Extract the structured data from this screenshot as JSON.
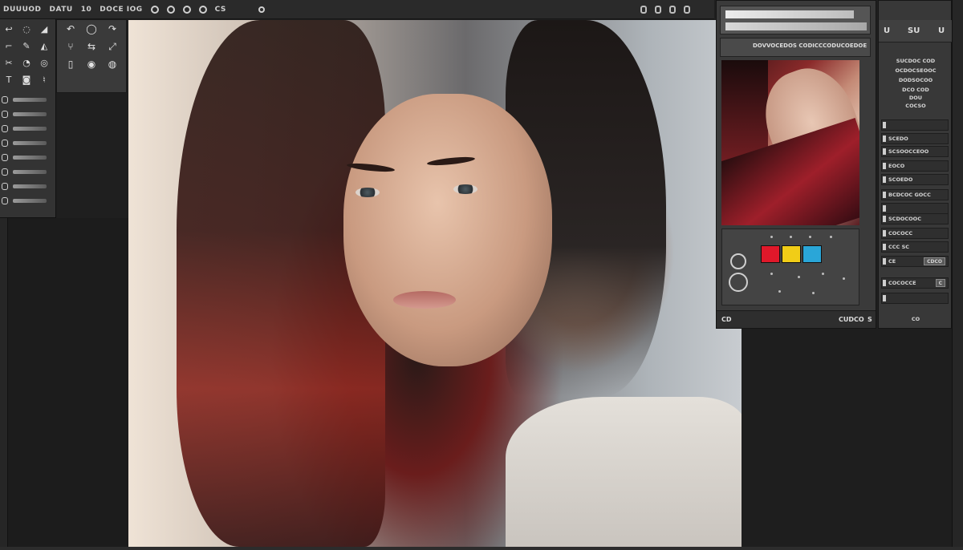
{
  "menubar": {
    "items": [
      "DUUUOD",
      "DATU",
      "10",
      "DOCE IOG",
      "CS"
    ]
  },
  "right_panel": {
    "header_label": "DOVVOCEDOS CODICCCODUCOEDOE",
    "swatches": [
      "#e0182a",
      "#f1cd17",
      "#2aa6d8"
    ],
    "status": {
      "left": "CD",
      "mid": "CUDCO",
      "right": "S"
    }
  },
  "far_panel": {
    "header": {
      "left": "U",
      "mid": "SU",
      "right": "U"
    },
    "description": [
      "SUCDOC COD",
      "OCDOCSEOOC",
      "DODSOCOO",
      "DCO COD",
      "DOU",
      "COCSO"
    ],
    "rows": [
      {
        "label": "",
        "tag": ""
      },
      {
        "label": "SCEDO",
        "tag": ""
      },
      {
        "label": "SCSOOCCEOO",
        "tag": ""
      },
      {
        "label": "EOCO",
        "tag": ""
      },
      {
        "label": "SCOEDO",
        "tag": ""
      },
      {
        "label": "BCDCOC GOCC",
        "tag": ""
      },
      {
        "label": "",
        "tag": ""
      },
      {
        "label": "SCDOCOOC",
        "tag": ""
      },
      {
        "label": "COCOCC",
        "tag": ""
      },
      {
        "label": "CCC SC",
        "tag": ""
      },
      {
        "label": "CE",
        "tag": "CDCO"
      },
      {
        "label": "COCOCCE",
        "tag": "C"
      },
      {
        "label": "",
        "tag": ""
      }
    ],
    "footer": "CO"
  },
  "colors": {
    "accent_red": "#e0182a",
    "accent_yellow": "#f1cd17",
    "accent_blue": "#2aa6d8",
    "panel_bg": "#3a3a3a"
  }
}
